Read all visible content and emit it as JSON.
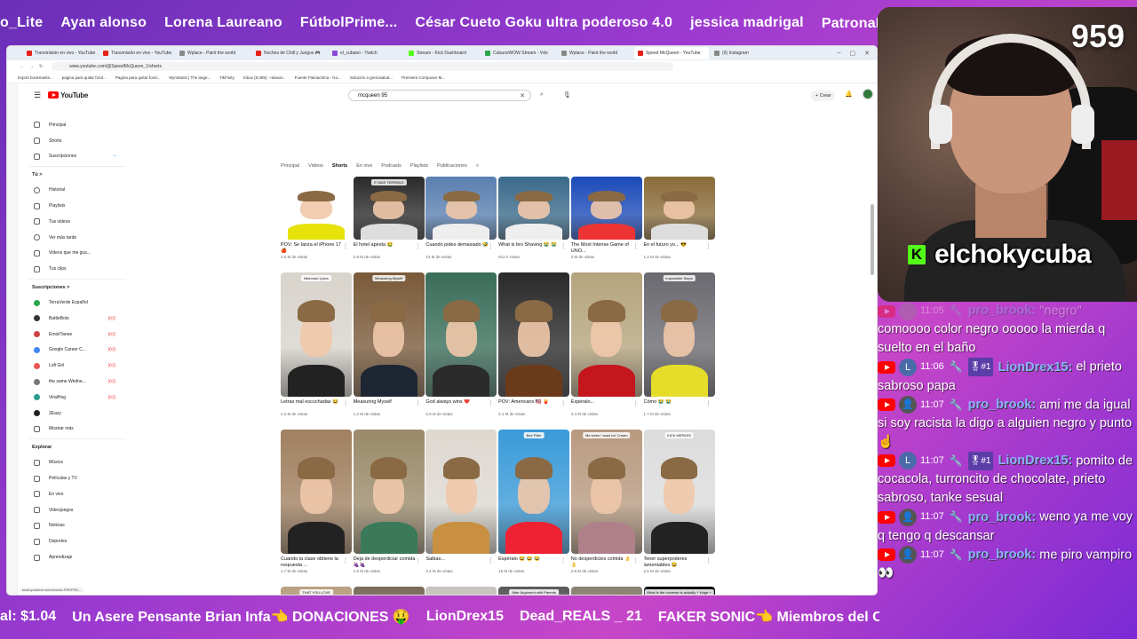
{
  "ticker_top": [
    "o_Lite",
    "Ayan alonso",
    "Lorena Laureano",
    "FútbolPrime...",
    "César Cueto Goku ultra poderoso 4.0",
    "jessica madrigal",
    "PatronaL:👈 Suscríbete"
  ],
  "ticker_bottom": [
    "al: $1.04",
    "Un Asere Pensante Brian Infa👈 DONACIONES 🤑",
    "LionDrex15",
    "Dead_REALS _ 21",
    "FAKER SONIC👈 Miembros del Canal 🌟"
  ],
  "browser": {
    "tabs": [
      {
        "label": "Transmisión en vivo - YouTube",
        "fav": "r"
      },
      {
        "label": "Transmisión en vivo - YouTube",
        "fav": "r"
      },
      {
        "label": "Wplace - Paint the world",
        "fav": "w"
      },
      {
        "label": "Noches de Chill y Juegos 🎮",
        "fav": "r"
      },
      {
        "label": "el_cubano - Twitch",
        "fav": "p"
      },
      {
        "label": "Stream - Kick Dashboard",
        "fav": "k"
      },
      {
        "label": "CubanoWOW Stream - Vdo",
        "fav": "g"
      },
      {
        "label": "Wplace - Paint the world",
        "fav": "w"
      },
      {
        "label": "Speed McQueen - YouTube",
        "fav": "r",
        "active": true
      },
      {
        "label": "(9) Instagram",
        "fav": "w"
      }
    ],
    "url": "www.youtube.com/@SpeedMcQueen_1/shorts",
    "bookmarks": [
      "Import bookmarks...",
      "pagina para quitar fond...",
      "Pagina para quitar fond...",
      "Mynstants | The large...",
      "TikFinity",
      "Inbox (8,399) - ralavar...",
      "Fuente Flamachina - Go...",
      "Solución a grenosalud...",
      "Premiere Composer M..."
    ],
    "status_url": "www.youtube.com/shorts/-FRKPKD..."
  },
  "youtube": {
    "logo": "YouTube",
    "search_value": "mcqueen 95",
    "create_label": "Crear",
    "sidebar": [
      {
        "type": "item",
        "label": "Principal",
        "icon": "home-icon"
      },
      {
        "type": "item",
        "label": "Shorts",
        "icon": "shorts-icon"
      },
      {
        "type": "item",
        "label": "Suscripciones",
        "icon": "subscriptions-icon",
        "dot": "•"
      },
      {
        "type": "section",
        "label": "Tú  >"
      },
      {
        "type": "item",
        "label": "Historial",
        "icon": "history-icon"
      },
      {
        "type": "item",
        "label": "Playlists",
        "icon": "playlist-icon"
      },
      {
        "type": "item",
        "label": "Tus videos",
        "icon": "video-icon"
      },
      {
        "type": "item",
        "label": "Ver más tarde",
        "icon": "clock-icon"
      },
      {
        "type": "item",
        "label": "Videos que me gus...",
        "icon": "like-icon"
      },
      {
        "type": "item",
        "label": "Tus clips",
        "icon": "clip-icon"
      },
      {
        "type": "section",
        "label": "Suscripciones  >"
      },
      {
        "type": "channel",
        "label": "TerraVerde Español",
        "color": "#2aa54a"
      },
      {
        "type": "channel",
        "label": "BattleBots",
        "color": "#333",
        "live": "((•))"
      },
      {
        "type": "channel",
        "label": "EmoiiTanee",
        "color": "#c44",
        "live": "((•))"
      },
      {
        "type": "channel",
        "label": "Google Career C...",
        "color": "#4285f4",
        "live": "((•))"
      },
      {
        "type": "channel",
        "label": "Lofi Girl",
        "color": "#e55",
        "live": "((•))"
      },
      {
        "type": "channel",
        "label": "the same Wedne...",
        "color": "#777",
        "live": "((•))"
      },
      {
        "type": "channel",
        "label": "ViralHog",
        "color": "#2a9d8f",
        "live": "((•))"
      },
      {
        "type": "channel",
        "label": "2Eazy",
        "color": "#222"
      },
      {
        "type": "item",
        "label": "Mostrar más",
        "icon": "chevron-down-icon"
      },
      {
        "type": "section",
        "label": "Explorar"
      },
      {
        "type": "item",
        "label": "Música",
        "icon": "music-icon"
      },
      {
        "type": "item",
        "label": "Películas y TV",
        "icon": "film-icon"
      },
      {
        "type": "item",
        "label": "En vivo",
        "icon": "live-icon"
      },
      {
        "type": "item",
        "label": "Videojuegos",
        "icon": "gamepad-icon"
      },
      {
        "type": "item",
        "label": "Noticias",
        "icon": "news-icon"
      },
      {
        "type": "item",
        "label": "Deportes",
        "icon": "trophy-icon"
      },
      {
        "type": "item",
        "label": "Aprendizaje",
        "icon": "bulb-icon"
      }
    ],
    "filters": [
      "Principal",
      "Videos",
      "Shorts",
      "En vivo",
      "Podcasts",
      "Playlists",
      "Publicaciones"
    ],
    "active_filter": "Shorts",
    "shorts_rows": [
      [
        {
          "title": "POV: Se lanza el iPhone 17 🍎",
          "views": "2.5 M de vistas",
          "bg": "#111",
          "accent": "#e6e20a",
          "tag": ""
        },
        {
          "title": "El hotel apesta 🤮",
          "views": "2.8 M de vistas",
          "bg": "#2a2a2a",
          "accent": "#ddd",
          "tag": "IT WAS TERRIBLE"
        },
        {
          "title": "Cuando pides demasiado 🤣",
          "views": "13 M de vistas",
          "bg": "#5a7fb0",
          "accent": "#eee",
          "tag": ""
        },
        {
          "title": "What is bro Shaving 😭 😭",
          "views": "812 k vistas",
          "bg": "#3a6a8a",
          "accent": "#eee",
          "tag": ""
        },
        {
          "title": "The Most Intense Game of UNO...",
          "views": "3 M de vistas",
          "bg": "#1b4ab8",
          "accent": "#e33",
          "tag": ""
        },
        {
          "title": "En el futuro yo... 😎",
          "views": "1.4 M de vistas",
          "bg": "#8a6c3a",
          "accent": "#ddd",
          "tag": ""
        }
      ],
      [
        {
          "title": "Letras mal escuchadas 😂",
          "views": "2.2 M de vistas",
          "bg": "#d8d4cc",
          "accent": "#222",
          "tag": "Misheard Lyrics"
        },
        {
          "title": "Measuring Myself",
          "views": "1.2 M de vistas",
          "bg": "#7a5a3a",
          "accent": "#1e2634",
          "tag": "Measuring Myself"
        },
        {
          "title": "God always wins ❤️",
          "views": "6.8 M de vistas",
          "bg": "#3a6e5a",
          "accent": "#2b2b2b",
          "tag": ""
        },
        {
          "title": "POV: Americans 🇺🇸 🍟",
          "views": "4.1 M de vistas",
          "bg": "#2a2a2a",
          "accent": "#6b3a1a",
          "tag": ""
        },
        {
          "title": "Espéralo...",
          "views": "3.4 M de vistas",
          "bg": "#b5a47d",
          "accent": "#c4161c",
          "tag": ""
        },
        {
          "title": "Cómo 😭 😭",
          "views": "1.7 M de vistas",
          "bg": "#6b6a70",
          "accent": "#e5dd2a",
          "tag": "Impossible Steps"
        }
      ],
      [
        {
          "title": "Cuando la clase obtiene la respuesta ...",
          "views": "1.7 M de vistas",
          "bg": "#a08060",
          "accent": "#222",
          "tag": ""
        },
        {
          "title": "Deja de desperdiciar comida 🍇🍇",
          "views": "1.9 M de vistas",
          "bg": "#9a8a6a",
          "accent": "#3a7a5a",
          "tag": ""
        },
        {
          "title": "Sabias...",
          "views": "3.4 M de vistas",
          "bg": "#ddd8d0",
          "accent": "#c89040",
          "tag": ""
        },
        {
          "title": "Espéralo 😂 😂 😂",
          "views": "16 M de vistas",
          "bg": "#3a9ad8",
          "accent": "#e23",
          "tag": "Box Filler"
        },
        {
          "title": "No desperdicies comida 👌👌",
          "views": "2.8 M de vistas",
          "bg": "#b89a80",
          "accent": "#b0808a",
          "tag": "Me when I want Ice Cream"
        },
        {
          "title": "Tener superpoderes lamentables 😂",
          "views": "2.6 M de vistas",
          "bg": "#dcdcdc",
          "accent": "#222",
          "tag": "KICK MEPASS"
        }
      ],
      [
        {
          "title": "",
          "views": "",
          "bg": "#b8a080",
          "accent": "#222",
          "tag": "THAT YOU LOVE"
        },
        {
          "title": "",
          "views": "",
          "bg": "#7a6a5a",
          "accent": "#2aa84a",
          "tag": ""
        },
        {
          "title": "",
          "views": "",
          "bg": "#c6c2bc",
          "accent": "#333",
          "tag": ""
        },
        {
          "title": "",
          "views": "",
          "bg": "#5a5a5a",
          "accent": "#ddd",
          "tag": "After Argument with Parents"
        },
        {
          "title": "",
          "views": "",
          "bg": "#8a8070",
          "accent": "#e8d0b0",
          "tag": ""
        },
        {
          "title": "",
          "views": "",
          "bg": "#0a0a12",
          "accent": "#555",
          "tag": "What is the universe is actually + Huge +"
        }
      ]
    ]
  },
  "stream": {
    "viewer_count": "959",
    "platform_icon": "kick-icon",
    "streamer_name": "elchokycuba"
  },
  "chat": [
    {
      "faded": true,
      "time": "11:05",
      "avatar": "",
      "avatar_color": "#8a8a8a",
      "user": "pro_brook:",
      "badge": "",
      "text": "\"negro\""
    },
    {
      "faded": false,
      "time": "",
      "avatar": "",
      "avatar_color": "",
      "user": "",
      "badge": "",
      "text": "comoooo color negro ooooo la mierda q suelto en el baño"
    },
    {
      "faded": false,
      "time": "11:06",
      "avatar": "L",
      "avatar_color": "#4a6aa8",
      "user": "LionDrex15:",
      "badge": "🎖#1",
      "text": "el prieto sabroso papa"
    },
    {
      "faded": false,
      "time": "11:07",
      "avatar": "👤",
      "avatar_color": "#555",
      "user": "pro_brook:",
      "badge": "",
      "text": "ami me da igual si soy racista la digo a alguien negro y punto ☝️"
    },
    {
      "faded": false,
      "time": "11:07",
      "avatar": "L",
      "avatar_color": "#4a6aa8",
      "user": "LionDrex15:",
      "badge": "🎖#1",
      "text": "pomito de cocacola, turroncito de chocolate, prieto sabroso, tanke sesual"
    },
    {
      "faded": false,
      "time": "11:07",
      "avatar": "👤",
      "avatar_color": "#555",
      "user": "pro_brook:",
      "badge": "",
      "text": "weno ya me voy q tengo q descansar"
    },
    {
      "faded": false,
      "time": "11:07",
      "avatar": "👤",
      "avatar_color": "#555",
      "user": "pro_brook:",
      "badge": "",
      "text": "me piro vampiro👀"
    }
  ]
}
